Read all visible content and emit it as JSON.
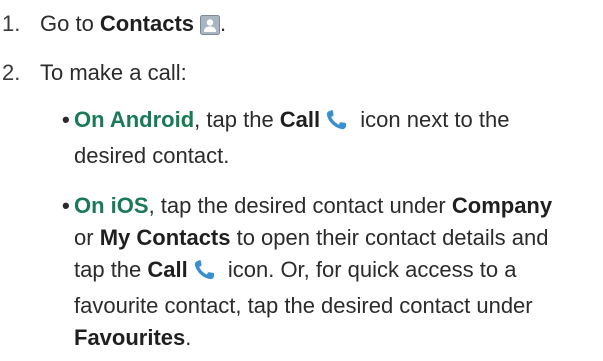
{
  "steps": [
    {
      "number": "1.",
      "prefix": "Go to ",
      "bold": "Contacts",
      "suffix": ".",
      "icon": "contacts-icon"
    },
    {
      "number": "2.",
      "text": "To make a call:"
    }
  ],
  "bullets": {
    "android": {
      "bold": "On Android",
      "text1": ", tap the ",
      "bold2": "Call",
      "text2": " icon next to the",
      "line2": "desired contact.",
      "icon": "phone-icon"
    },
    "ios": {
      "bold": "On iOS",
      "text1": ", tap the desired contact under ",
      "bold2": "Company",
      "line2_pre": "or ",
      "line2_bold": "My Contacts",
      "line2_post": " to open their contact details and",
      "line3_pre": "tap the ",
      "line3_bold": "Call",
      "line3_post": " icon. Or, for quick access to a",
      "line4": "favourite contact, tap the desired contact under",
      "line5_bold": "Favourites",
      "line5_post": ".",
      "icon": "phone-icon"
    }
  },
  "colors": {
    "text": "#2b2b2b",
    "emphasis_green": "#1a7a57",
    "icon_blue": "#3a8fcf"
  }
}
